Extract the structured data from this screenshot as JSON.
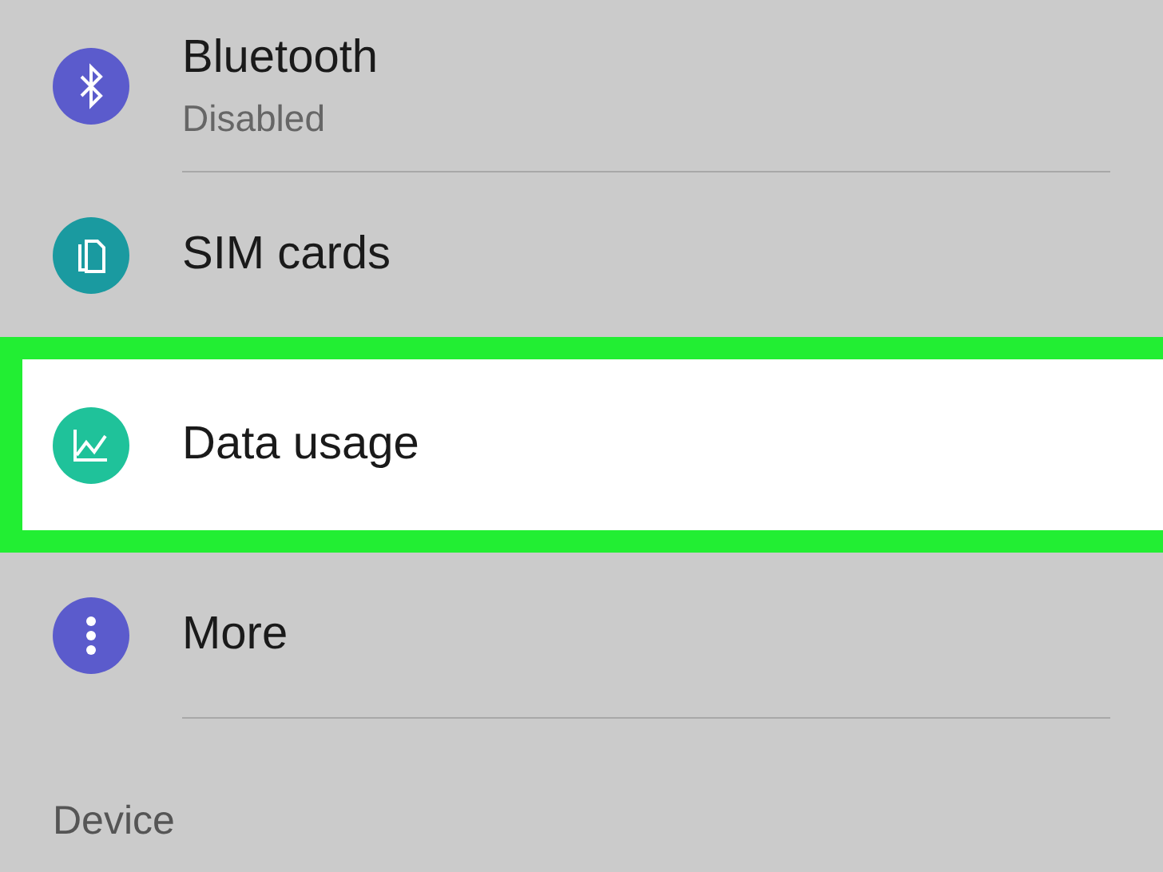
{
  "settings_items": [
    {
      "title": "Bluetooth",
      "subtitle": "Disabled",
      "color": "#5b5bcc",
      "selected": false
    },
    {
      "title": "SIM cards",
      "color": "#1a9aa0",
      "selected": false
    },
    {
      "title": "Data usage",
      "color": "#1fc29a",
      "selected": true
    },
    {
      "title": "More",
      "color": "#5b5bcc",
      "selected": false
    }
  ],
  "section_header": "Device"
}
